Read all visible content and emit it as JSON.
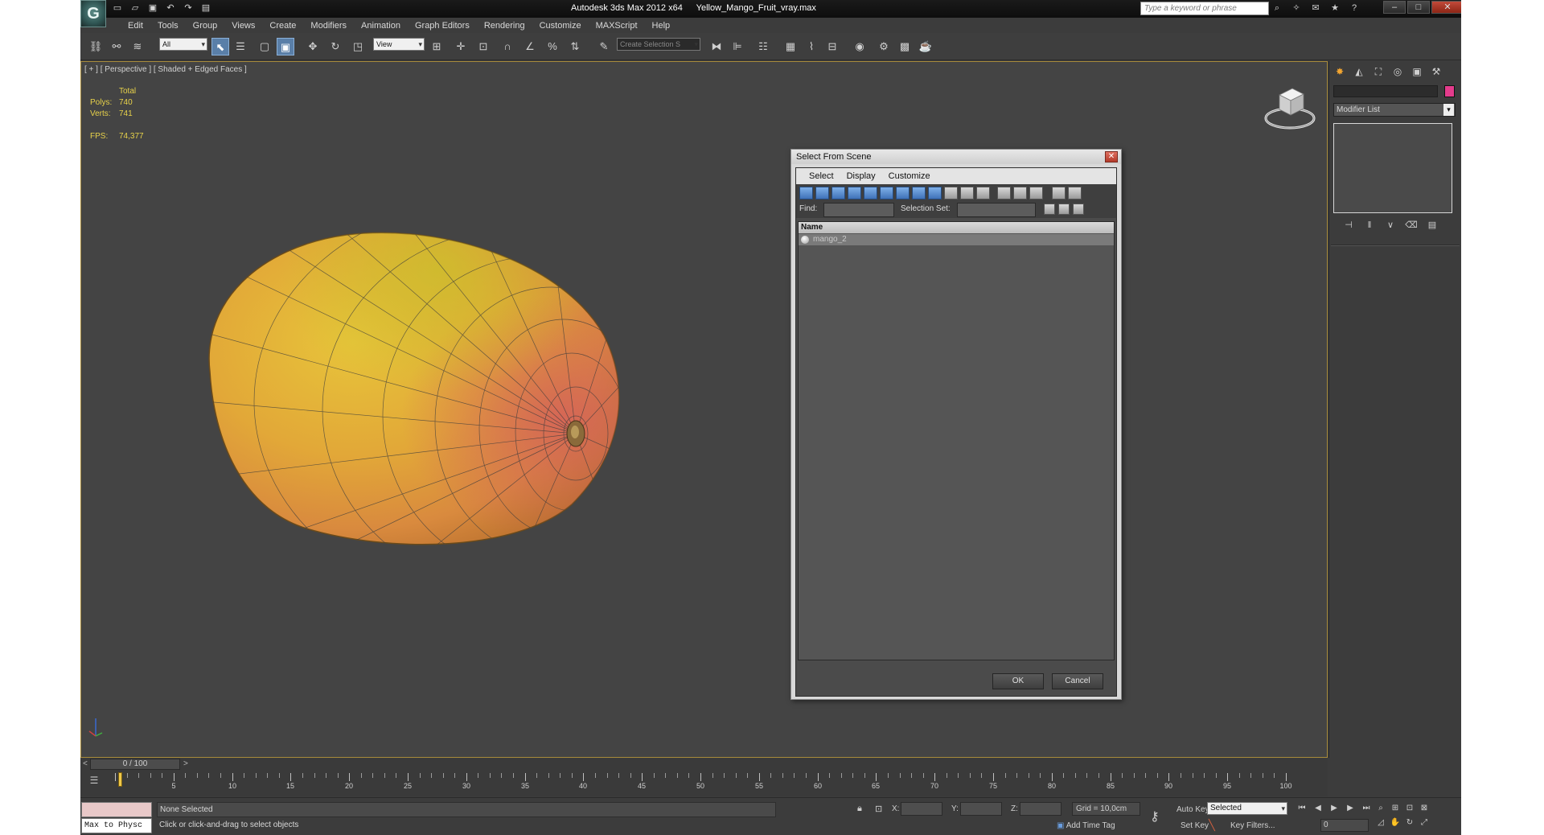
{
  "app": {
    "logo_text": "G",
    "title": "Autodesk 3ds Max  2012 x64",
    "filename": "Yellow_Mango_Fruit_vray.max",
    "search_placeholder": "Type a keyword or phrase"
  },
  "quick_access": [
    "new-icon",
    "open-icon",
    "save-icon",
    "undo-icon",
    "redo-icon",
    "project-icon"
  ],
  "menu": [
    "Edit",
    "Tools",
    "Group",
    "Views",
    "Create",
    "Modifiers",
    "Animation",
    "Graph Editors",
    "Rendering",
    "Customize",
    "MAXScript",
    "Help"
  ],
  "toolbar": {
    "filter_value": "All",
    "coord_value": "View",
    "named_selection": "Create Selection S"
  },
  "viewport": {
    "label": "[ + ] [ Perspective ] [ Shaded + Edged Faces ]",
    "stats": {
      "total_label": "Total",
      "polys_label": "Polys:",
      "polys_value": "740",
      "verts_label": "Verts:",
      "verts_value": "741",
      "fps_label": "FPS:",
      "fps_value": "74,377"
    }
  },
  "dialog": {
    "title": "Select From Scene",
    "menu": [
      "Select",
      "Display",
      "Customize"
    ],
    "find_label": "Find:",
    "selection_set_label": "Selection Set:",
    "column_name": "Name",
    "items": [
      "mango_2"
    ],
    "ok_label": "OK",
    "cancel_label": "Cancel"
  },
  "command_panel": {
    "modifier_list": "Modifier List",
    "object_color": "#e43c8c"
  },
  "timeline": {
    "slider_text": "0 / 100",
    "prev_label": "<",
    "next_label": ">",
    "ruler_labels": [
      "5",
      "10",
      "15",
      "20",
      "25",
      "30",
      "35",
      "40",
      "45",
      "50",
      "55",
      "60",
      "65",
      "70",
      "75",
      "80",
      "85",
      "90",
      "95",
      "100"
    ]
  },
  "status": {
    "maxscript_text": "Max to Physc",
    "selection_status": "None Selected",
    "prompt": "Click or click-and-drag to select objects",
    "x_label": "X:",
    "y_label": "Y:",
    "z_label": "Z:",
    "grid": "Grid = 10,0cm",
    "add_time_tag": "Add Time Tag",
    "auto_key": "Auto Key",
    "set_key": "Set Key",
    "selected_value": "Selected",
    "key_filters": "Key Filters...",
    "frame_value": "0"
  },
  "colors": {
    "viewport_bg": "#444444",
    "active_border": "#a68a3a",
    "stats_text": "#e8d24a",
    "selection_blue": "#5a7fa8"
  }
}
